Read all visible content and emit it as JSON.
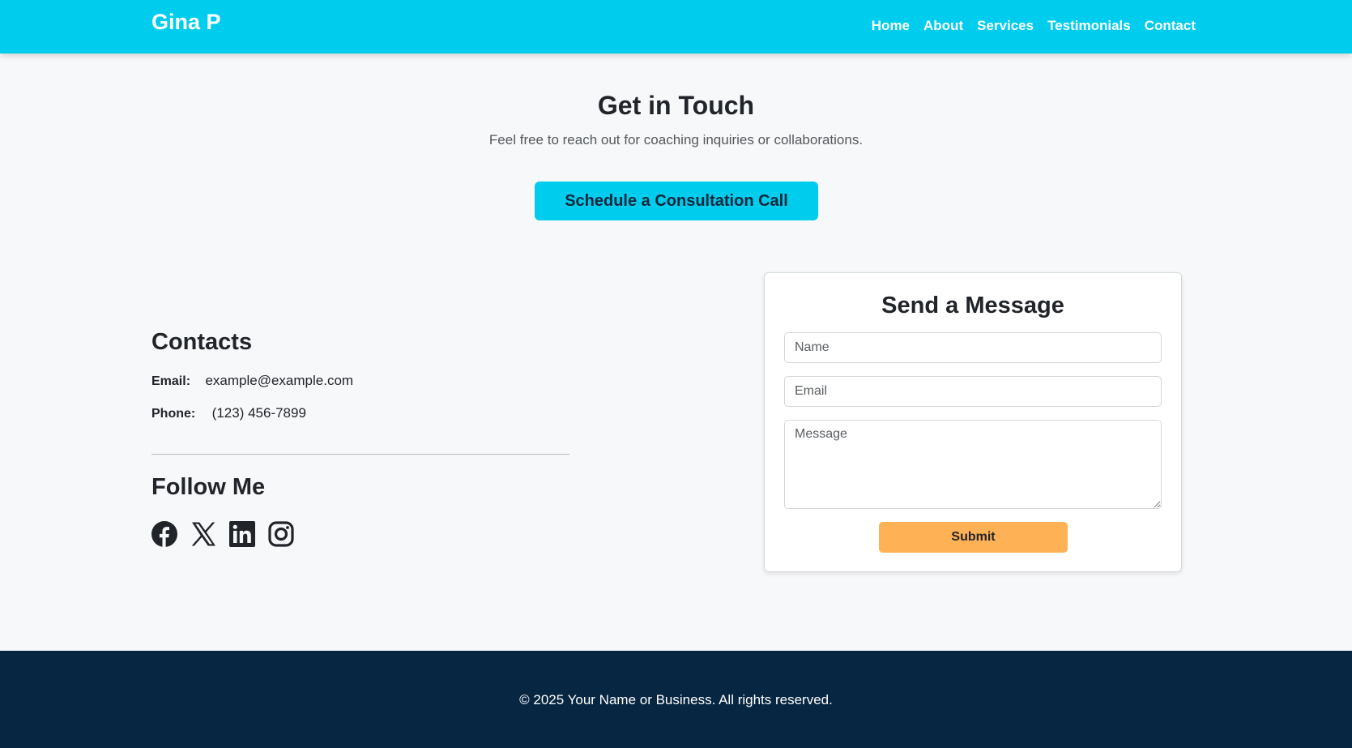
{
  "colors": {
    "navbar": "#00ccee",
    "cta": "#00ccee",
    "submit": "#ffb155",
    "footer": "#072641",
    "page_bg": "#f7f8fa"
  },
  "nav": {
    "brand": "Gina P",
    "links": [
      "Home",
      "About",
      "Services",
      "Testimonials",
      "Contact"
    ]
  },
  "hero": {
    "title": "Get in Touch",
    "subtitle": "Feel free to reach out for coaching inquiries or collaborations.",
    "cta_label": "Schedule a Consultation Call"
  },
  "contacts": {
    "title": "Contacts",
    "email_label": "Email:",
    "email_value": "example@example.com",
    "phone_label": "Phone:",
    "phone_value": "(123) 456-7899"
  },
  "follow": {
    "title": "Follow Me",
    "icons": [
      "facebook-icon",
      "x-icon",
      "linkedin-icon",
      "instagram-icon"
    ]
  },
  "form": {
    "title": "Send a Message",
    "name_placeholder": "Name",
    "email_placeholder": "Email",
    "message_placeholder": "Message",
    "submit_label": "Submit"
  },
  "footer": {
    "text": "© 2025 Your Name or Business. All rights reserved."
  }
}
